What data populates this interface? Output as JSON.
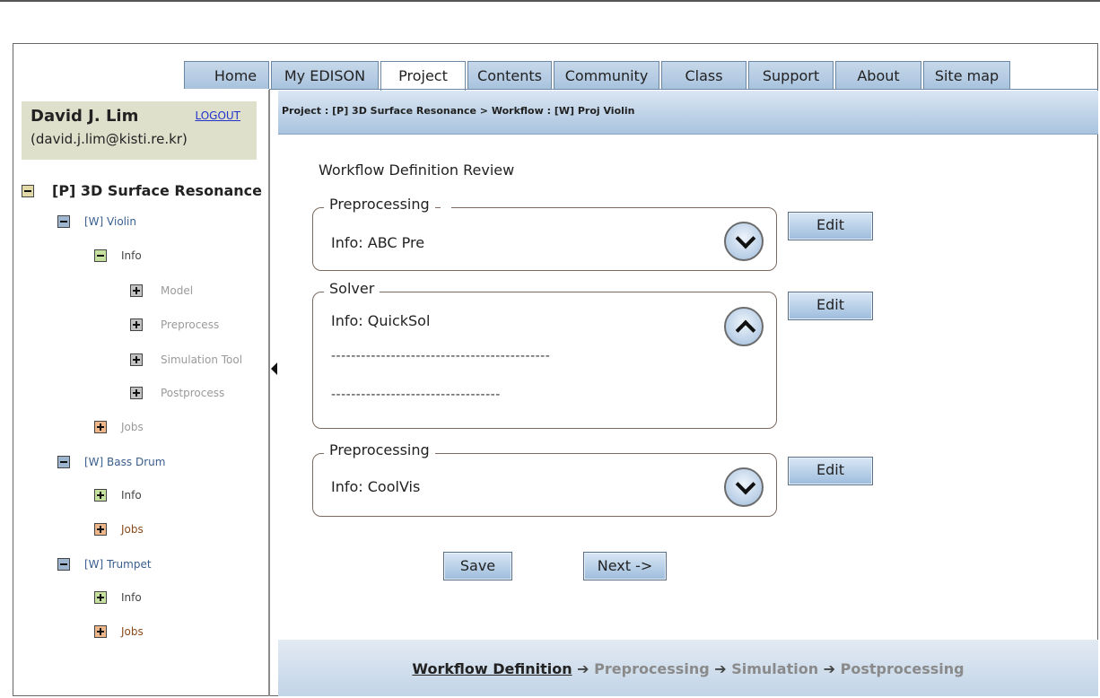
{
  "nav": {
    "tabs": [
      {
        "label": "Home",
        "active": false
      },
      {
        "label": "My EDISON",
        "active": false
      },
      {
        "label": "Project",
        "active": true
      },
      {
        "label": "Contents",
        "active": false
      },
      {
        "label": "Community",
        "active": false
      },
      {
        "label": "Class",
        "active": false
      },
      {
        "label": "Support",
        "active": false
      },
      {
        "label": "About",
        "active": false
      },
      {
        "label": "Site map",
        "active": false
      }
    ]
  },
  "user": {
    "name": "David J. Lim",
    "email": "(david.j.lim@kisti.re.kr)",
    "logout": "LOGOUT"
  },
  "tree": {
    "project": "[P] 3D Surface Resonance",
    "items": [
      {
        "label": "[W] Violin",
        "color": "#3a5e8c"
      },
      {
        "label": "Info",
        "color": "#444"
      },
      {
        "label": "Model",
        "color": "#9a9a9a"
      },
      {
        "label": "Preprocess",
        "color": "#9a9a9a"
      },
      {
        "label": "Simulation Tool",
        "color": "#9a9a9a"
      },
      {
        "label": "Postprocess",
        "color": "#9a9a9a"
      },
      {
        "label": "Jobs",
        "color": "#9a9a9a"
      },
      {
        "label": "[W] Bass Drum",
        "color": "#3a5e8c"
      },
      {
        "label": "Info",
        "color": "#444"
      },
      {
        "label": "Jobs",
        "color": "#8a4a1a"
      },
      {
        "label": "[W] Trumpet",
        "color": "#3a5e8c"
      },
      {
        "label": "Info",
        "color": "#444"
      },
      {
        "label": "Jobs",
        "color": "#8a4a1a"
      }
    ]
  },
  "main": {
    "breadcrumb": "Project : [P] 3D Surface Resonance > Workflow : [W] Proj Violin",
    "title": "Workflow Definition Review",
    "sections": [
      {
        "legend": "Preprocessing",
        "info": "Info: ABC Pre",
        "expanded": false,
        "edit": "Edit"
      },
      {
        "legend": "Solver",
        "info": "Info: QuickSol",
        "expanded": true,
        "edit": "Edit",
        "lines": [
          "--------------------------------------------",
          "----------------------------------"
        ]
      },
      {
        "legend": "Preprocessing",
        "info": "Info: CoolVis",
        "expanded": false,
        "edit": "Edit"
      }
    ],
    "save": "Save",
    "next": "Next ->"
  },
  "footer": {
    "steps": [
      "Workflow Definition",
      "Preprocessing",
      "Simulation",
      "Postprocessing"
    ],
    "arrow": "➔"
  }
}
